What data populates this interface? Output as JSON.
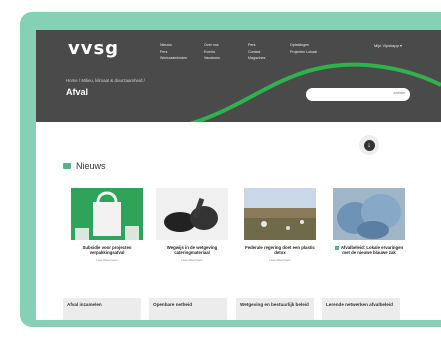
{
  "site": {
    "logo": "vvsg",
    "nav": [
      [
        "Nieuws",
        "Pers",
        "Werkzaamheden"
      ],
      [
        "Over ons",
        "Events",
        "Vacatures"
      ],
      [
        "Pers",
        "Contact",
        "Magazines"
      ],
      [
        "Opleidingen",
        "Projecten Lokaal"
      ]
    ],
    "language": "Mijn Vipskapp ▾"
  },
  "page": {
    "breadcrumb": "Home / Milieu, klimaat & duurzaamheid /",
    "title": "Afval",
    "search_button": "zoeken"
  },
  "news": {
    "title": "Nieuws",
    "cards": [
      {
        "title": "Subsidie voor projecten verpakkingsafval",
        "meta": "Lees Meer/open"
      },
      {
        "title": "Wegwijs in de wetgeving cateringmateriaal",
        "meta": "Lees Meer/open"
      },
      {
        "title": "Federale regering doet een plastic detox",
        "meta": "Lees Meer/open"
      },
      {
        "title": "Afvalbeleid: Lokale ervaringen met de nieuwe blauwe zak",
        "meta": ""
      }
    ]
  },
  "bottom_boxes": [
    "Afval inzamelen",
    "Openbare netheid",
    "Wetgeving en bestuurlijk beleid",
    "Lerende netwerken afvalbeleid"
  ],
  "colors": {
    "accent_green": "#52b788",
    "teal_frame": "#86d0b5",
    "header_gray": "#4a4a4a",
    "wave_green": "#2fb24b"
  }
}
